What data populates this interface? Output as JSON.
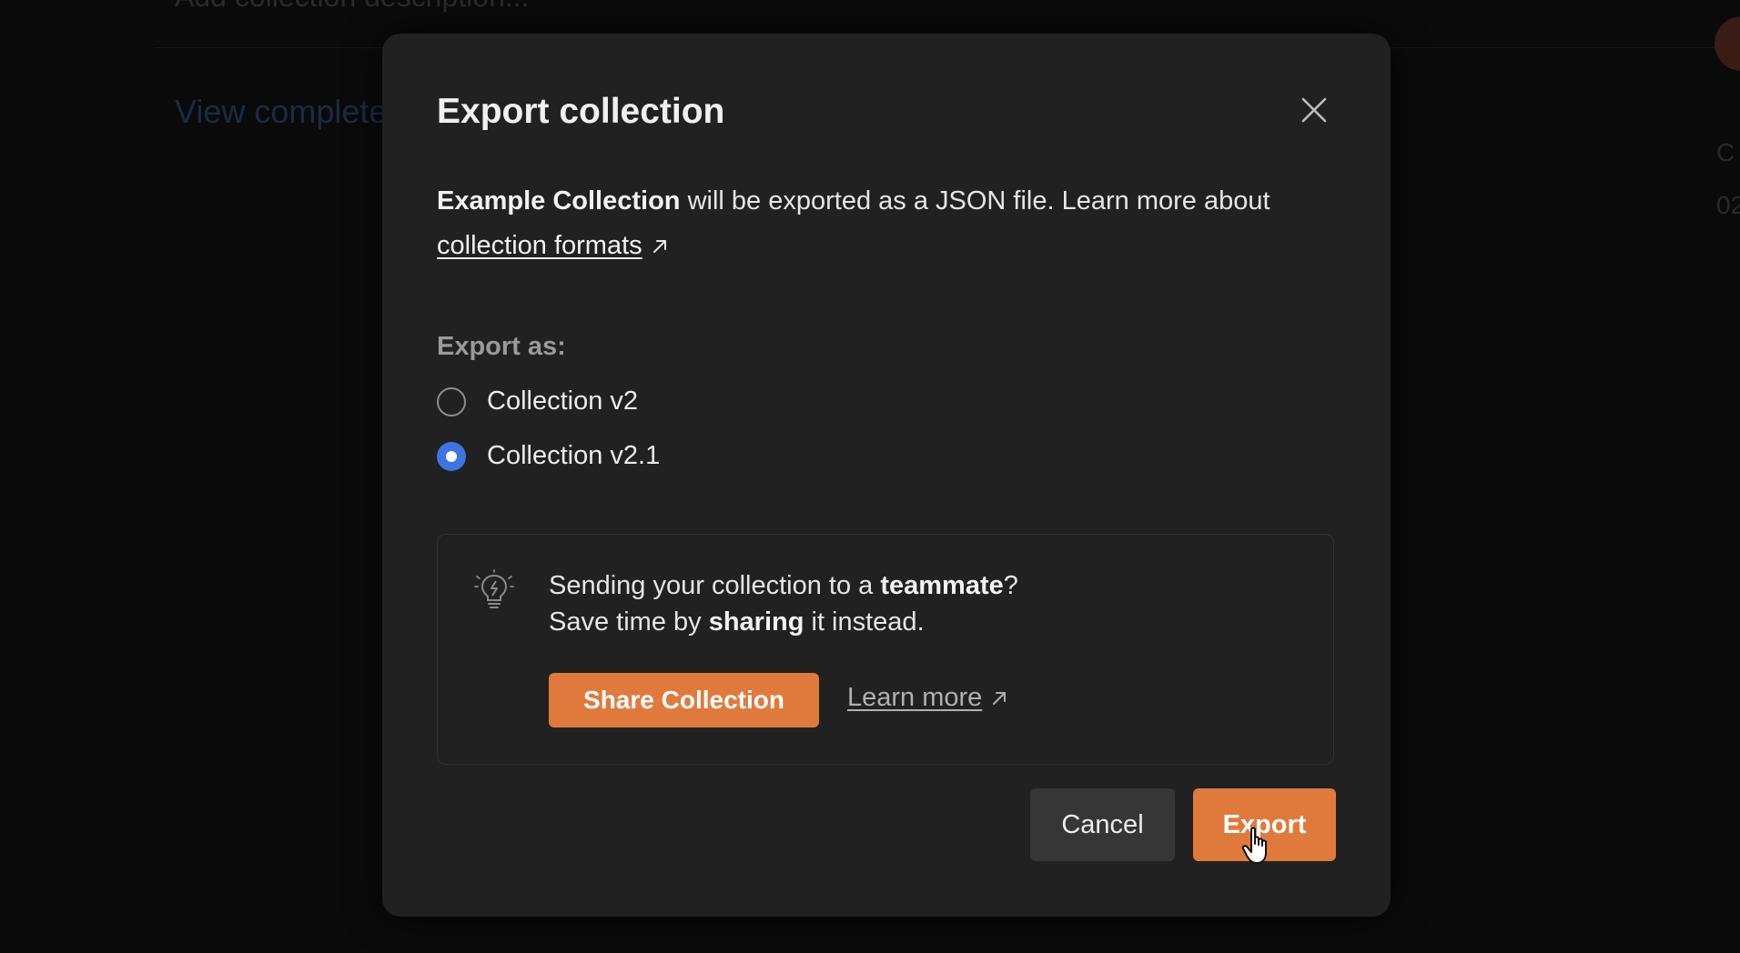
{
  "background": {
    "top_text": "Add collection description...",
    "view_link": "View complete",
    "side_text_1": "C",
    "side_text_2": "02"
  },
  "modal": {
    "title": "Export collection",
    "description": {
      "collection_name": "Example Collection",
      "text": " will be exported as a JSON file. Learn more about ",
      "link_label": "collection formats"
    },
    "export_as_label": "Export as:",
    "options": [
      {
        "label": "Collection v2",
        "selected": false
      },
      {
        "label": "Collection v2.1",
        "selected": true
      }
    ],
    "tip": {
      "line1_prefix": "Sending your collection to a ",
      "line1_bold": "teammate",
      "line1_suffix": "?",
      "line2_prefix": "Save time by ",
      "line2_bold": "sharing",
      "line2_suffix": " it instead.",
      "share_button": "Share Collection",
      "learn_more": "Learn more"
    },
    "cancel_label": "Cancel",
    "export_label": "Export"
  },
  "colors": {
    "accent_orange": "#e07a3c",
    "radio_blue": "#3d74e0",
    "modal_bg": "#212121"
  },
  "icons": {
    "close": "close-icon",
    "external": "external-link-icon",
    "tip": "lightbulb-icon",
    "cursor": "hand-pointer-icon"
  }
}
